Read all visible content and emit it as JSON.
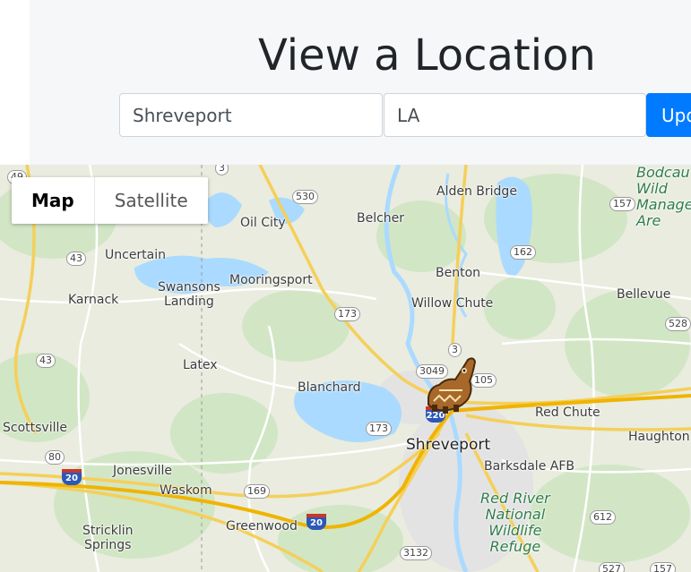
{
  "header": {
    "title": "View a Location",
    "city_value": "Shreveport",
    "state_value": "LA",
    "update_label": "Upd"
  },
  "map": {
    "type_controls": {
      "map_label": "Map",
      "satellite_label": "Satellite",
      "selected": "Map"
    },
    "labels": {
      "alden_bridge": "Alden Bridge",
      "bodcau": "Bodcau\nWild\nManage\nAre",
      "oil_city": "Oil City",
      "belcher": "Belcher",
      "uncertain": "Uncertain",
      "benton": "Benton",
      "swansons_landing": "Swansons\nLanding",
      "mooringsport": "Mooringsport",
      "bellevue": "Bellevue",
      "karnack": "Karnack",
      "willow_chute": "Willow Chute",
      "latex": "Latex",
      "blanchard": "Blanchard",
      "red_chute": "Red Chute",
      "scottsville": "Scottsville",
      "haughton": "Haughton",
      "shreveport": "Shreveport",
      "jonesville": "Jonesville",
      "barksdale_afb": "Barksdale AFB",
      "waskom": "Waskom",
      "red_river_refuge": "Red River\nNational\nWildlife\nRefuge",
      "stricklin_springs": "Stricklin\nSprings",
      "greenwood": "Greenwood"
    },
    "route_shields": [
      "49",
      "3",
      "530",
      "157",
      "43",
      "162",
      "528",
      "173",
      "3",
      "43",
      "3049",
      "105",
      "220",
      "173",
      "80",
      "20",
      "169",
      "20",
      "612",
      "3132",
      "527",
      "157"
    ],
    "marker": "pixel-cat-bus-marker"
  }
}
